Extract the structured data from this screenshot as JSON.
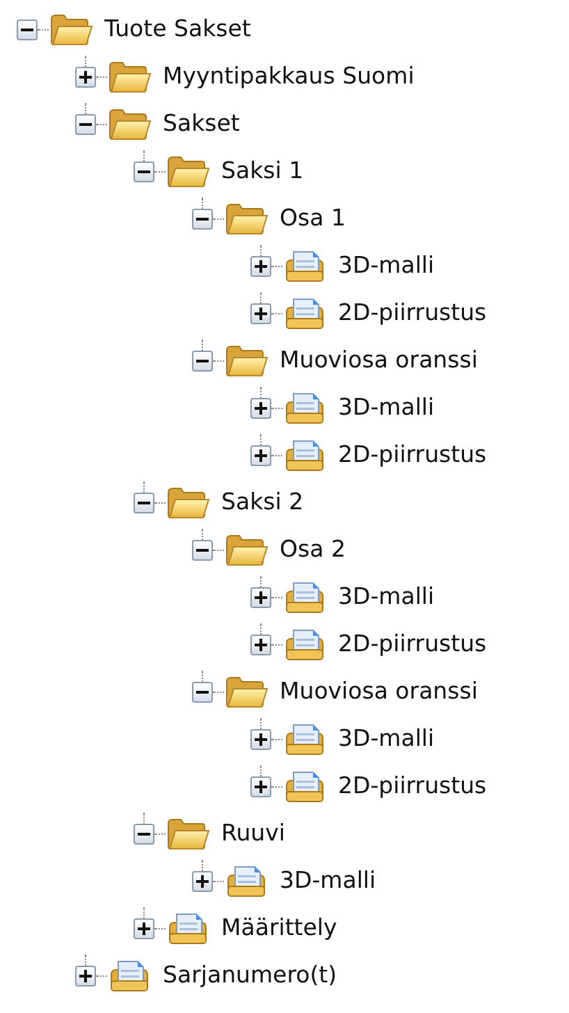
{
  "tree": [
    {
      "label": "Tuote Sakset",
      "kind": "folder",
      "expanded": true,
      "children": [
        {
          "label": "Myyntipakkaus Suomi",
          "kind": "folder",
          "expanded": false
        },
        {
          "label": "Sakset",
          "kind": "folder",
          "expanded": true,
          "children": [
            {
              "label": "Saksi 1",
              "kind": "folder",
              "expanded": true,
              "children": [
                {
                  "label": "Osa 1",
                  "kind": "folder",
                  "expanded": true,
                  "children": [
                    {
                      "label": "3D-malli",
                      "kind": "document",
                      "expanded": false
                    },
                    {
                      "label": "2D-piirrustus",
                      "kind": "document",
                      "expanded": false
                    }
                  ]
                },
                {
                  "label": "Muoviosa oranssi",
                  "kind": "folder",
                  "expanded": true,
                  "children": [
                    {
                      "label": "3D-malli",
                      "kind": "document",
                      "expanded": false
                    },
                    {
                      "label": "2D-piirrustus",
                      "kind": "document",
                      "expanded": false
                    }
                  ]
                }
              ]
            },
            {
              "label": "Saksi 2",
              "kind": "folder",
              "expanded": true,
              "children": [
                {
                  "label": "Osa 2",
                  "kind": "folder",
                  "expanded": true,
                  "children": [
                    {
                      "label": "3D-malli",
                      "kind": "document",
                      "expanded": false
                    },
                    {
                      "label": "2D-piirrustus",
                      "kind": "document",
                      "expanded": false
                    }
                  ]
                },
                {
                  "label": "Muoviosa oranssi",
                  "kind": "folder",
                  "expanded": true,
                  "children": [
                    {
                      "label": "3D-malli",
                      "kind": "document",
                      "expanded": false
                    },
                    {
                      "label": "2D-piirrustus",
                      "kind": "document",
                      "expanded": false
                    }
                  ]
                }
              ]
            },
            {
              "label": "Ruuvi",
              "kind": "folder",
              "expanded": true,
              "children": [
                {
                  "label": "3D-malli",
                  "kind": "document",
                  "expanded": false
                }
              ]
            },
            {
              "label": "Määrittely",
              "kind": "document",
              "expanded": false
            }
          ]
        },
        {
          "label": "Sarjanumero(t)",
          "kind": "document",
          "expanded": false
        }
      ]
    }
  ]
}
